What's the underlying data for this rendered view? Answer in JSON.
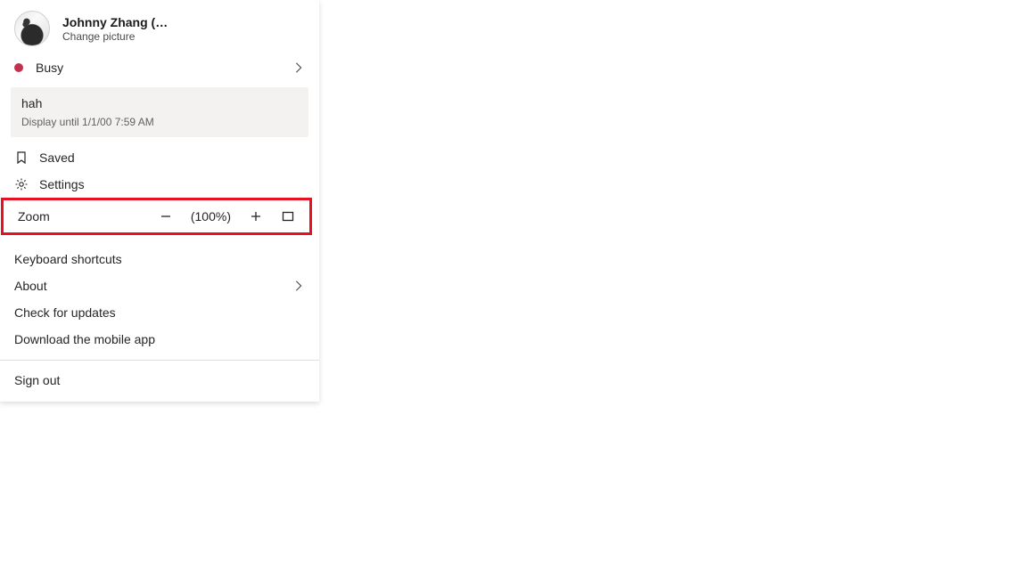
{
  "profile": {
    "name": "Johnny Zhang (…",
    "subtitle": "Change picture"
  },
  "status": {
    "label": "Busy",
    "color": "#c4314b"
  },
  "status_message": {
    "text": "hah",
    "subtitle": "Display until 1/1/00 7:59 AM"
  },
  "items": {
    "saved": "Saved",
    "settings": "Settings"
  },
  "zoom": {
    "label": "Zoom",
    "value": "(100%)"
  },
  "menu": {
    "keyboard": "Keyboard shortcuts",
    "about": "About",
    "updates": "Check for updates",
    "download": "Download the mobile app"
  },
  "signout": "Sign out"
}
